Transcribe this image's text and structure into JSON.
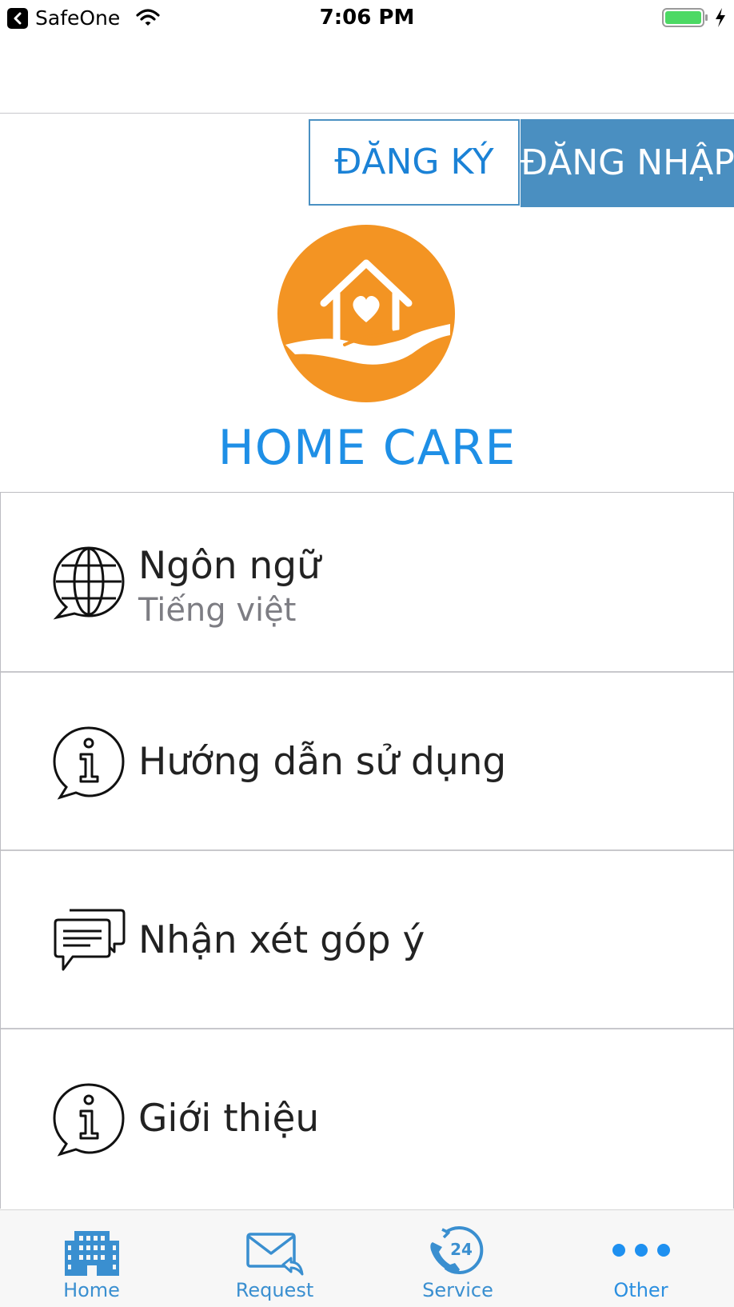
{
  "status_bar": {
    "carrier": "SafeOne",
    "time": "7:06 PM",
    "battery_color": "#4cd964"
  },
  "auth": {
    "register_label": "ĐĂNG KÝ",
    "login_label": "ĐĂNG NHẬP"
  },
  "brand": {
    "name": "HOME CARE",
    "logo_color": "#f39423",
    "name_color": "#1e8fe6"
  },
  "menu": {
    "items": [
      {
        "title": "Ngôn ngữ",
        "subtitle": "Tiếng việt",
        "icon": "globe-chat-icon"
      },
      {
        "title": "Hướng dẫn sử dụng",
        "icon": "info-chat-icon"
      },
      {
        "title": "Nhận xét góp ý",
        "icon": "comments-icon"
      },
      {
        "title": "Giới thiệu",
        "icon": "info-chat-icon"
      }
    ]
  },
  "tabs": [
    {
      "label": "Home",
      "icon": "building-icon"
    },
    {
      "label": "Request",
      "icon": "mail-reply-icon"
    },
    {
      "label": "Service",
      "icon": "phone-24-icon",
      "badge": "24"
    },
    {
      "label": "Other",
      "icon": "more-dots-icon"
    }
  ]
}
